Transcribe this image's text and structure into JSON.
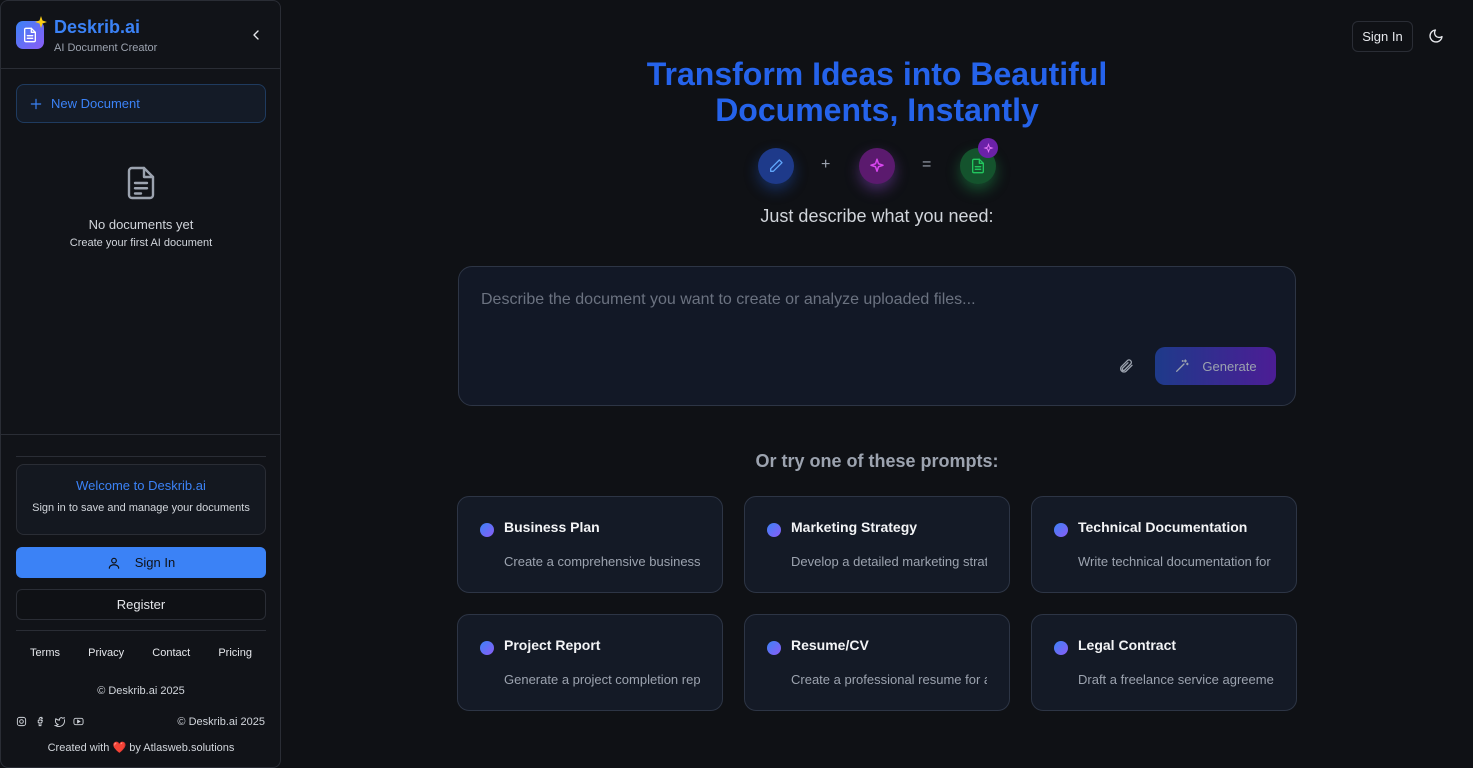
{
  "sidebar": {
    "brand_name": "Deskrib.ai",
    "brand_sub": "AI Document Creator",
    "new_document": "New Document",
    "empty_title": "No documents yet",
    "empty_sub": "Create your first AI document",
    "welcome_title": "Welcome to Deskrib.ai",
    "welcome_sub": "Sign in to save and manage your documents",
    "sign_in": "Sign In",
    "register": "Register",
    "footer_links": [
      "Terms",
      "Privacy",
      "Contact",
      "Pricing"
    ],
    "copyright": "© Deskrib.ai 2025",
    "social_copyright": "© Deskrib.ai 2025",
    "created_prefix": "Created with",
    "created_suffix": "by Atlasweb.solutions"
  },
  "topbar": {
    "sign_in": "Sign In"
  },
  "hero": {
    "title_line1": "Transform Ideas into Beautiful",
    "title_line2": "Documents, Instantly",
    "op_plus": "+",
    "op_equals": "=",
    "tagline": "Just describe what you need:"
  },
  "prompt": {
    "placeholder": "Describe the document you want to create or analyze uploaded files...",
    "value": "",
    "generate": "Generate"
  },
  "suggestions": {
    "title": "Or try one of these prompts:",
    "cards": [
      {
        "title": "Business Plan",
        "desc": "Create a comprehensive business p"
      },
      {
        "title": "Marketing Strategy",
        "desc": "Develop a detailed marketing strateg"
      },
      {
        "title": "Technical Documentation",
        "desc": "Write technical documentation for a"
      },
      {
        "title": "Project Report",
        "desc": "Generate a project completion repor"
      },
      {
        "title": "Resume/CV",
        "desc": "Create a professional resume for a s"
      },
      {
        "title": "Legal Contract",
        "desc": "Draft a freelance service agreement"
      }
    ]
  },
  "colors": {
    "accent": "#3b82f6",
    "title_blue": "#2563eb",
    "purple": "#8b5cf6",
    "green": "#22c55e",
    "background": "#0f1115"
  }
}
